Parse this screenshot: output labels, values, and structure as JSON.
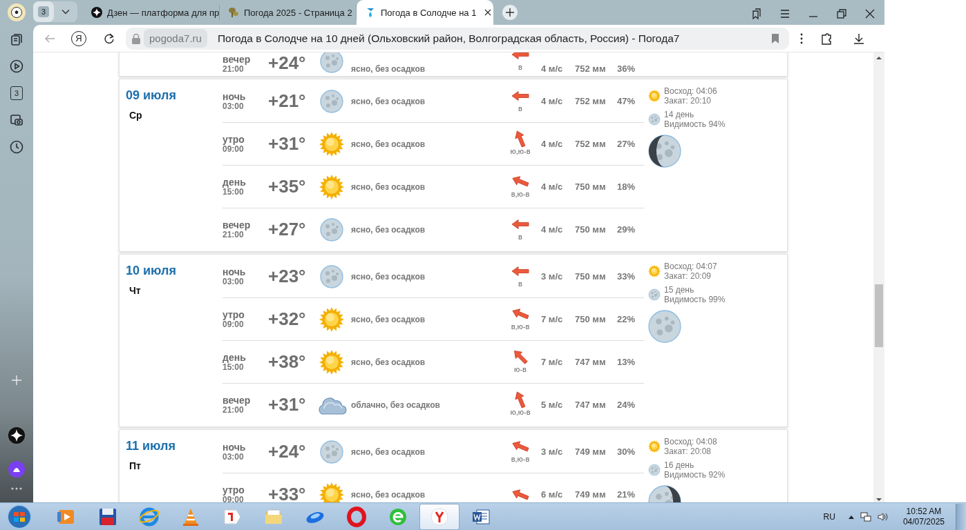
{
  "browser": {
    "sidebar": {
      "counter": "3"
    },
    "tab_group": {
      "count": "3"
    },
    "tabs": [
      {
        "kind": "zen",
        "title": "Дзен — платформа для пр",
        "selected": false
      },
      {
        "kind": "mushroom",
        "title": "Погода 2025 - Страница 2",
        "selected": false
      },
      {
        "kind": "drop",
        "title": "Погода в Солодче на 1",
        "selected": true
      }
    ],
    "address": {
      "yandex_button": "Я",
      "domain": "pogoda7.ru",
      "title": "Погода в Солодче на 10 дней (Ольховский район, Волгоградская область, Россия) - Погода7"
    }
  },
  "forecast": [
    {
      "rows": [
        {
          "period": "вечер",
          "time": "21:00",
          "temp": "+24°",
          "icon": {
            "kind": "moon"
          },
          "description": "ясно, без осадков",
          "arrow": {
            "kind": "e"
          },
          "wind_from": "в",
          "wind": "4 м/с",
          "pressure": "752 мм",
          "humidity": "36%"
        }
      ]
    },
    {
      "date": "09 июля",
      "weekday": "Ср",
      "sunrise": "Восход: 04:06",
      "sunset": "Закат: 20:10",
      "moon_age": "14 день",
      "visibility": "Видимость 94%",
      "moon_phase": {
        "kind": "waxing"
      },
      "rows": [
        {
          "period": "ночь",
          "time": "03:00",
          "temp": "+21°",
          "icon": {
            "kind": "moon"
          },
          "description": "ясно, без осадков",
          "arrow": {
            "kind": "e"
          },
          "wind_from": "в",
          "wind": "4 м/с",
          "pressure": "752 мм",
          "humidity": "47%"
        },
        {
          "period": "утро",
          "time": "09:00",
          "temp": "+31°",
          "icon": {
            "kind": "sun"
          },
          "description": "ясно, без осадков",
          "arrow": {
            "kind": "sse"
          },
          "wind_from": "ю,ю-в",
          "wind": "4 м/с",
          "pressure": "752 мм",
          "humidity": "27%"
        },
        {
          "period": "день",
          "time": "15:00",
          "temp": "+35°",
          "icon": {
            "kind": "sun"
          },
          "description": "ясно, без осадков",
          "arrow": {
            "kind": "ese"
          },
          "wind_from": "в,ю-в",
          "wind": "4 м/с",
          "pressure": "750 мм",
          "humidity": "18%"
        },
        {
          "period": "вечер",
          "time": "21:00",
          "temp": "+27°",
          "icon": {
            "kind": "moon"
          },
          "description": "ясно, без осадков",
          "arrow": {
            "kind": "e"
          },
          "wind_from": "в",
          "wind": "4 м/с",
          "pressure": "750 мм",
          "humidity": "29%"
        }
      ]
    },
    {
      "date": "10 июля",
      "weekday": "Чт",
      "sunrise": "Восход: 04:07",
      "sunset": "Закат: 20:09",
      "moon_age": "15 день",
      "visibility": "Видимость 99%",
      "moon_phase": {
        "kind": "full"
      },
      "rows": [
        {
          "period": "ночь",
          "time": "03:00",
          "temp": "+23°",
          "icon": {
            "kind": "moon"
          },
          "description": "ясно, без осадков",
          "arrow": {
            "kind": "e"
          },
          "wind_from": "в",
          "wind": "3 м/с",
          "pressure": "750 мм",
          "humidity": "33%"
        },
        {
          "period": "утро",
          "time": "09:00",
          "temp": "+32°",
          "icon": {
            "kind": "sun"
          },
          "description": "ясно, без осадков",
          "arrow": {
            "kind": "ese"
          },
          "wind_from": "в,ю-в",
          "wind": "7 м/с",
          "pressure": "750 мм",
          "humidity": "22%"
        },
        {
          "period": "день",
          "time": "15:00",
          "temp": "+38°",
          "icon": {
            "kind": "sun"
          },
          "description": "ясно, без осадков",
          "arrow": {
            "kind": "se"
          },
          "wind_from": "ю-в",
          "wind": "7 м/с",
          "pressure": "747 мм",
          "humidity": "13%"
        },
        {
          "period": "вечер",
          "time": "21:00",
          "temp": "+31°",
          "icon": {
            "kind": "cloud"
          },
          "description": "облачно, без осадков",
          "arrow": {
            "kind": "sse"
          },
          "wind_from": "ю,ю-в",
          "wind": "5 м/с",
          "pressure": "747 мм",
          "humidity": "24%"
        }
      ]
    },
    {
      "date": "11 июля",
      "weekday": "Пт",
      "sunrise": "Восход: 04:08",
      "sunset": "Закат: 20:08",
      "moon_age": "16 день",
      "visibility": "Видимость 92%",
      "moon_phase": {
        "kind": "waning"
      },
      "rows": [
        {
          "period": "ночь",
          "time": "03:00",
          "temp": "+24°",
          "icon": {
            "kind": "moon"
          },
          "description": "ясно, без осадков",
          "arrow": {
            "kind": "ese"
          },
          "wind_from": "в,ю-в",
          "wind": "3 м/с",
          "pressure": "749 мм",
          "humidity": "30%"
        },
        {
          "period": "утро",
          "time": "09:00",
          "temp": "+33°",
          "icon": {
            "kind": "sun"
          },
          "description": "ясно, без осадков",
          "arrow": {
            "kind": "ese"
          },
          "wind": "6 м/с",
          "pressure": "749 мм",
          "humidity": "21%"
        }
      ]
    }
  ],
  "taskbar": {
    "language": "RU",
    "time": "10:52 AM",
    "date": "04/07/2025"
  }
}
